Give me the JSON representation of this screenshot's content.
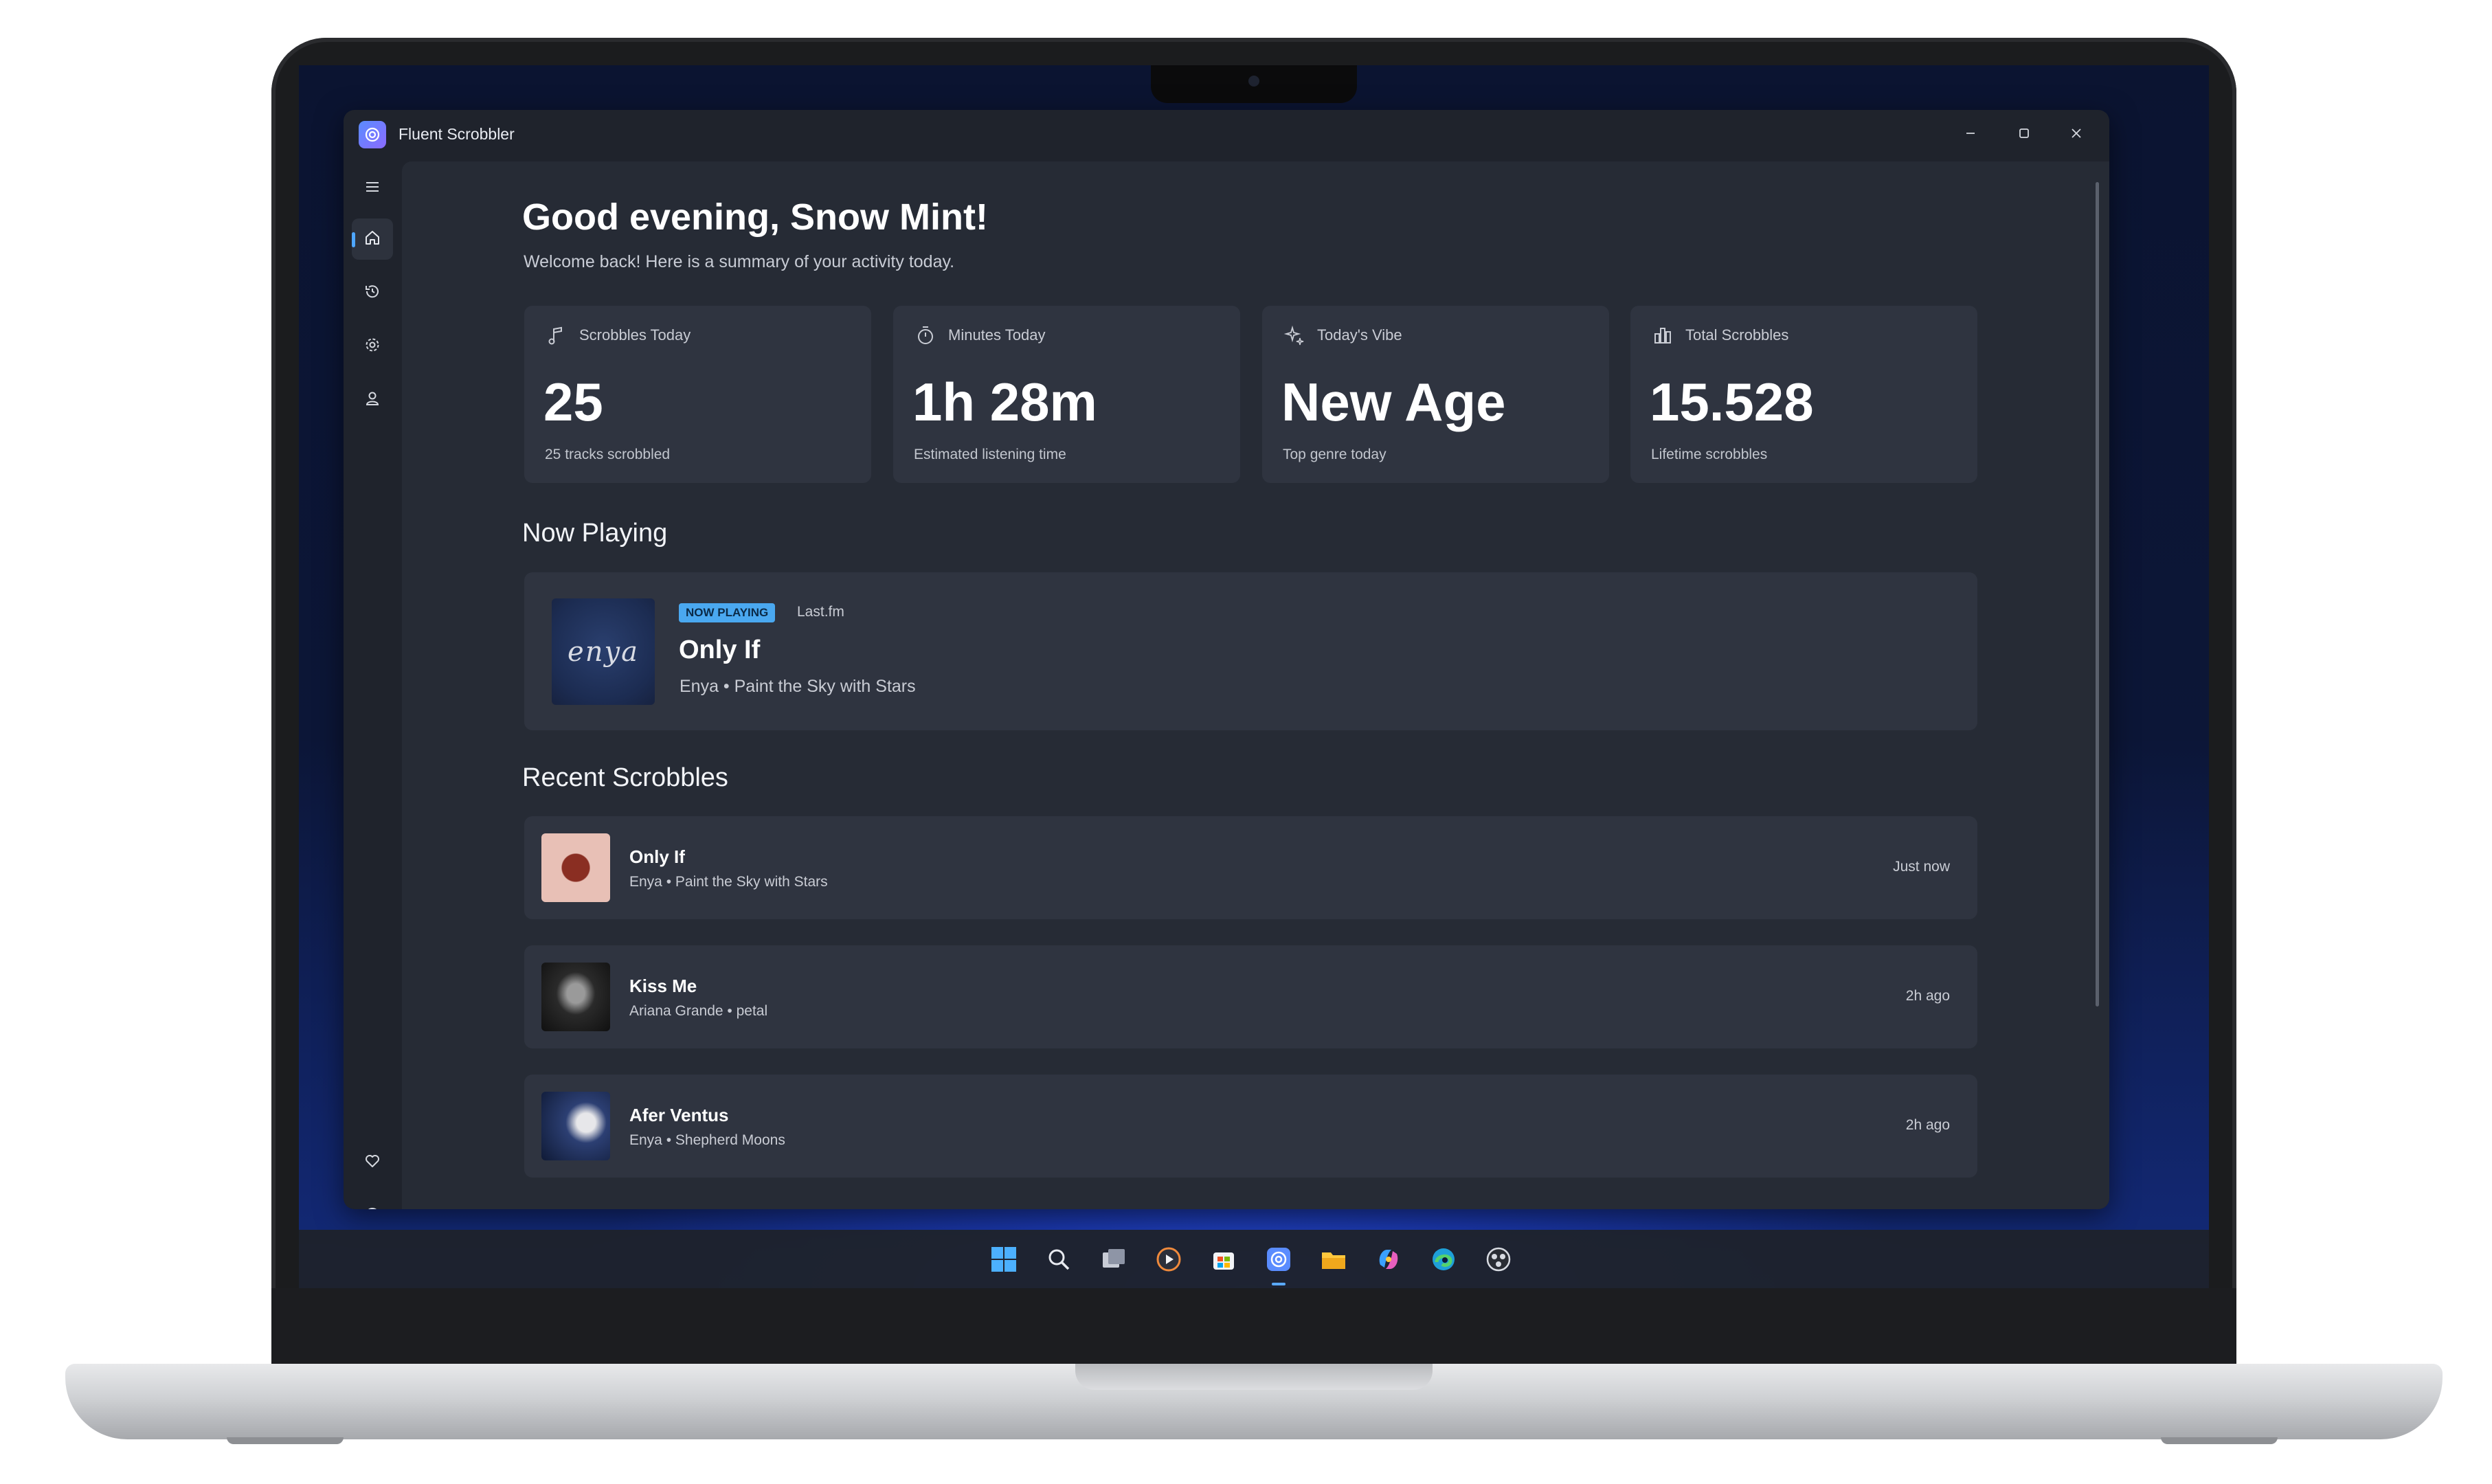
{
  "window": {
    "title": "Fluent Scrobbler"
  },
  "nav": {
    "items": [
      "menu-icon",
      "home-icon",
      "history-icon",
      "settings-icon",
      "profile-icon"
    ],
    "bottom_items": [
      "heart-icon",
      "info-icon"
    ],
    "active": "home-icon"
  },
  "header": {
    "greeting": "Good evening, Snow Mint!",
    "subtitle": "Welcome back! Here is a summary of your activity today."
  },
  "stats": [
    {
      "icon": "music-note-icon",
      "label": "Scrobbles Today",
      "value": "25",
      "caption": "25 tracks scrobbled"
    },
    {
      "icon": "timer-icon",
      "label": "Minutes Today",
      "value": "1h 28m",
      "caption": "Estimated listening time"
    },
    {
      "icon": "sparkle-icon",
      "label": "Today's Vibe",
      "value": "New Age",
      "caption": "Top genre today"
    },
    {
      "icon": "bar-chart-icon",
      "label": "Total Scrobbles",
      "value": "15.528",
      "caption": "Lifetime scrobbles"
    }
  ],
  "now_playing": {
    "section_title": "Now Playing",
    "badge": "NOW PLAYING",
    "source": "Last.fm",
    "title": "Only If",
    "subtitle": "Enya • Paint the Sky with Stars",
    "art_text": "enya"
  },
  "recent": {
    "section_title": "Recent Scrobbles",
    "items": [
      {
        "title": "Only If",
        "subtitle": "Enya • Paint the Sky with Stars",
        "time": "Just now"
      },
      {
        "title": "Kiss Me",
        "subtitle": "Ariana Grande • petal",
        "time": "2h ago"
      },
      {
        "title": "Afer Ventus",
        "subtitle": "Enya • Shepherd Moons",
        "time": "2h ago"
      }
    ]
  },
  "taskbar": {
    "icons": [
      "windows-start-icon",
      "search-icon",
      "task-view-icon",
      "media-player-icon",
      "store-icon",
      "fluent-scrobbler-icon",
      "file-explorer-icon",
      "copilot-icon",
      "edge-icon",
      "obs-icon"
    ],
    "active": "fluent-scrobbler-icon"
  },
  "colors": {
    "accent": "#4ea6ff",
    "badge": "#4aa8f0",
    "card": "#2f3440",
    "content_bg": "#262b35"
  }
}
